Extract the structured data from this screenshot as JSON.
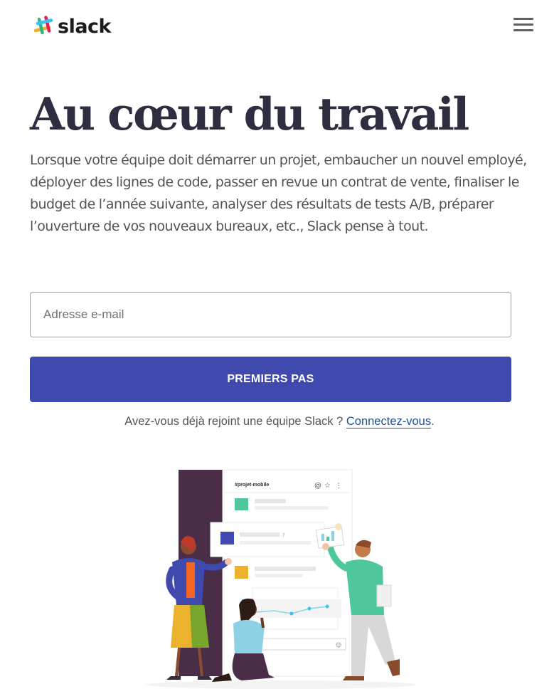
{
  "header": {
    "logo_text": "slack",
    "menu_icon": "hamburger-menu-icon"
  },
  "hero": {
    "title": "Au cœur du travail",
    "description": "Lorsque votre équipe doit démarrer un projet, embaucher un nouvel employé, déployer des lignes de code, passer en revue un contrat de vente, finaliser le budget de l’année suivante, analyser des résultats de tests A/B, préparer l’ouverture de vos nouveaux bureaux, etc., Slack pense à tout."
  },
  "signup": {
    "email_placeholder": "Adresse e-mail",
    "email_value": "",
    "button_label": "PREMIERS PAS",
    "existing_prefix": "Avez-vous déjà rejoint une équipe Slack ? ",
    "signin_link": "Connectez-vous",
    "existing_suffix": "."
  },
  "illustration": {
    "channel_name": "#projet-mobile"
  },
  "colors": {
    "brand_purple": "#4049ae",
    "title_text": "#2d2e40",
    "aubergine": "#4a2d47"
  }
}
